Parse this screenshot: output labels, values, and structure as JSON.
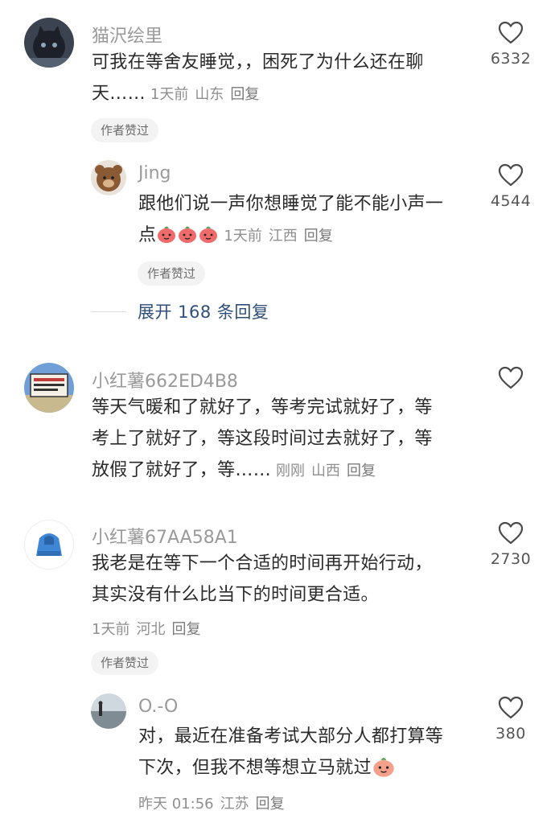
{
  "comments": [
    {
      "username": "猫沢绘里",
      "lines": [
        "可我在等舍友睡觉，，困死了为什么还在聊",
        "天……"
      ],
      "time": "1天前",
      "location": "山东",
      "reply": "回复",
      "likes": "6332",
      "badge": "作者赞过",
      "replies": [
        {
          "username": "Jing",
          "lines": [
            "跟他们说一声你想睡觉了能不能小声一",
            "点"
          ],
          "time": "1天前",
          "location": "江西",
          "reply": "回复",
          "likes": "4544",
          "badge": "作者赞过",
          "emoji": [
            "peach-face-icon",
            "peach-face-icon",
            "peach-face-icon"
          ]
        }
      ],
      "expand_label": "展开 168 条回复"
    },
    {
      "username": "小红薯662ED4B8",
      "lines": [
        "等天气暖和了就好了，等考完试就好了，等",
        "考上了就好了，等这段时间过去就好了，等",
        "放假了就好了，等……"
      ],
      "time": "刚刚",
      "location": "山西",
      "reply": "回复",
      "likes": ""
    },
    {
      "username": "小红薯67AA58A1",
      "lines": [
        "我老是在等下一个合适的时间再开始行动，",
        "其实没有什么比当下的时间更合适。"
      ],
      "time": "1天前",
      "location": "河北",
      "reply": "回复",
      "likes": "2730",
      "badge": "作者赞过",
      "replies": [
        {
          "username": "O.-O",
          "lines": [
            "对，最近在准备考试大部分人都打算等",
            "下次，但我不想等想立马就过"
          ],
          "time": "昨天 01:56",
          "location": "江苏",
          "reply": "回复",
          "likes": "380",
          "emoji": [
            "peach-face-icon"
          ]
        }
      ]
    }
  ],
  "icons": {
    "like": "heart-outline-icon"
  },
  "colors": {
    "username": "#9a9a9a",
    "text": "#2a2a2a",
    "meta": "#8f8f8f",
    "badge_bg": "#f3f3f3",
    "expand_link": "#2f4e7a"
  }
}
